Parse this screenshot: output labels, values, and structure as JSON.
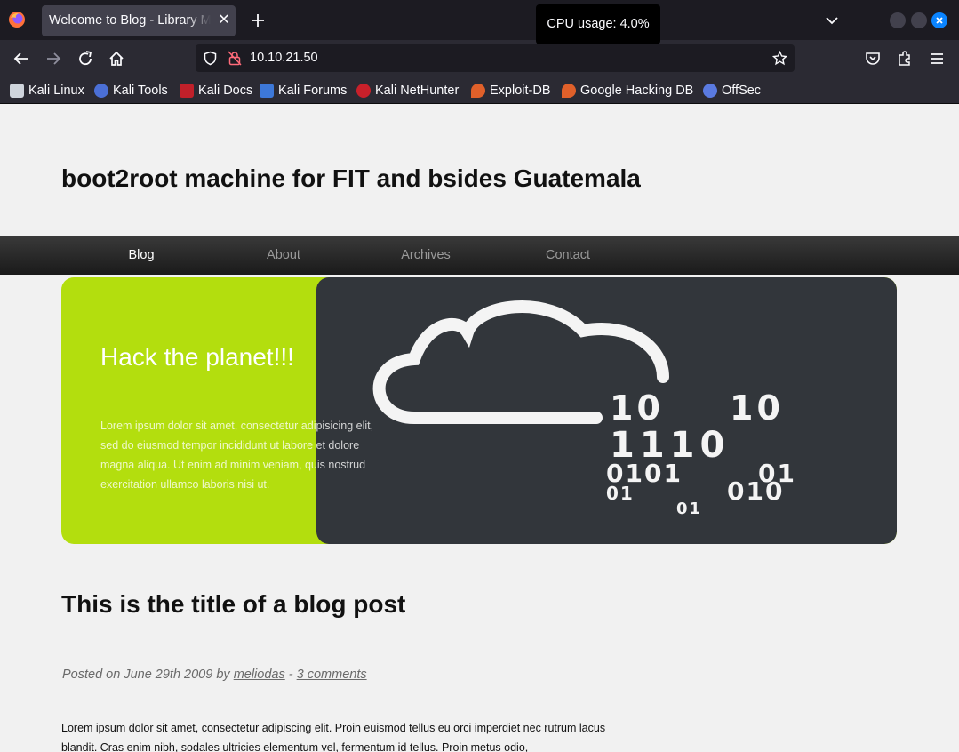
{
  "browser": {
    "tab_title": "Welcome to Blog - Library Management",
    "tooltip": "CPU usage: 4.0%",
    "url": "10.10.21.50",
    "bookmarks": [
      {
        "label": "Kali Linux",
        "icon": "kali-dragon-icon",
        "color": "#cfd4dc"
      },
      {
        "label": "Kali Tools",
        "icon": "kali-tools-icon",
        "color": "#4b6fd6"
      },
      {
        "label": "Kali Docs",
        "icon": "kali-docs-icon",
        "color": "#c0202a"
      },
      {
        "label": "Kali Forums",
        "icon": "kali-forums-icon",
        "color": "#3d78d8"
      },
      {
        "label": "Kali NetHunter",
        "icon": "kali-nethunter-icon",
        "color": "#c8202a"
      },
      {
        "label": "Exploit-DB",
        "icon": "exploit-db-icon",
        "color": "#e0602a"
      },
      {
        "label": "Google Hacking DB",
        "icon": "ghdb-icon",
        "color": "#e0602a"
      },
      {
        "label": "OffSec",
        "icon": "offsec-icon",
        "color": "#5a7ae0"
      }
    ]
  },
  "site": {
    "title": "boot2root machine for FIT and bsides Guatemala",
    "nav": [
      "Blog",
      "About",
      "Archives",
      "Contact"
    ],
    "hero": {
      "title": "Hack the planet!!!",
      "text": "Lorem ipsum dolor sit amet, consectetur adipisicing elit, sed do eiusmod tempor incididunt ut labore et dolore magna aliqua. Ut enim ad minim veniam, quis nostrud exercitation ullamco laboris nisi ut.",
      "binary": [
        "10",
        "10",
        "1110",
        "0101",
        "01",
        "01",
        "010",
        "01"
      ],
      "accent": "#b3de0e"
    },
    "post": {
      "title": "This is the title of a blog post",
      "meta_prefix": "Posted on June 29th 2009 by",
      "author": "meliodas",
      "separator": "-",
      "comments": "3 comments",
      "body": "Lorem ipsum dolor sit amet, consectetur adipiscing elit. Proin euismod tellus eu orci imperdiet nec rutrum lacus blandit. Cras enim nibh, sodales ultricies elementum vel, fermentum id tellus. Proin metus odio,"
    }
  }
}
